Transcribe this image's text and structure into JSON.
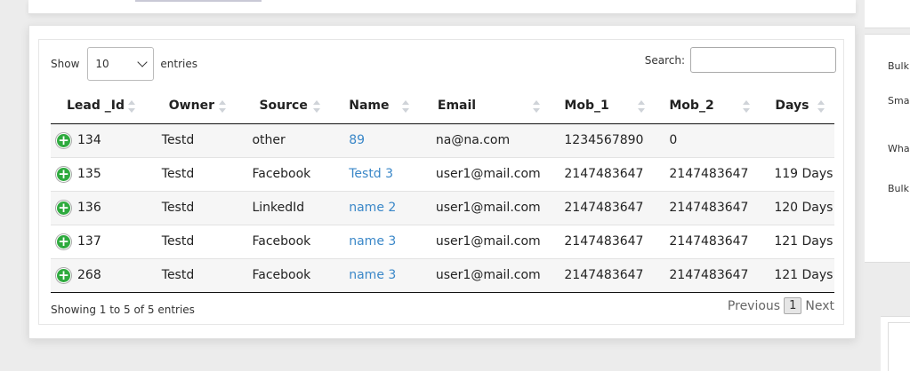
{
  "length_menu": {
    "show_label": "Show",
    "value": "10",
    "entries_label": "entries"
  },
  "search": {
    "label": "Search:",
    "value": ""
  },
  "columns": [
    "Lead _Id",
    "Owner",
    "Source",
    "Name",
    "Email",
    "Mob_1",
    "Mob_2",
    "Days"
  ],
  "rows": [
    {
      "lead_id": "134",
      "owner": "Testd",
      "source": "other",
      "name": "89",
      "email": "na@na.com",
      "mob_1": "1234567890",
      "mob_2": "0",
      "days": ""
    },
    {
      "lead_id": "135",
      "owner": "Testd",
      "source": "Facebook",
      "name": "Testd 3",
      "email": "user1@mail.com",
      "mob_1": "2147483647",
      "mob_2": "2147483647",
      "days": "119 Days"
    },
    {
      "lead_id": "136",
      "owner": "Testd",
      "source": "LinkedId",
      "name": "name 2",
      "email": "user1@mail.com",
      "mob_1": "2147483647",
      "mob_2": "2147483647",
      "days": "120 Days"
    },
    {
      "lead_id": "137",
      "owner": "Testd",
      "source": "Facebook",
      "name": "name 3",
      "email": "user1@mail.com",
      "mob_1": "2147483647",
      "mob_2": "2147483647",
      "days": "121 Days"
    },
    {
      "lead_id": "268",
      "owner": "Testd",
      "source": "Facebook",
      "name": "name 3",
      "email": "user1@mail.com",
      "mob_1": "2147483647",
      "mob_2": "2147483647",
      "days": "121 Days"
    }
  ],
  "info": "Showing 1 to 5 of 5 entries",
  "pagination": {
    "previous": "Previous",
    "current": "1",
    "next": "Next"
  },
  "side_panel": {
    "items": [
      "Bulk",
      "Sma",
      "Wha",
      "Bulk"
    ]
  },
  "colors": {
    "link": "#3a87c8",
    "expand_icon": "#2eaa3e"
  }
}
